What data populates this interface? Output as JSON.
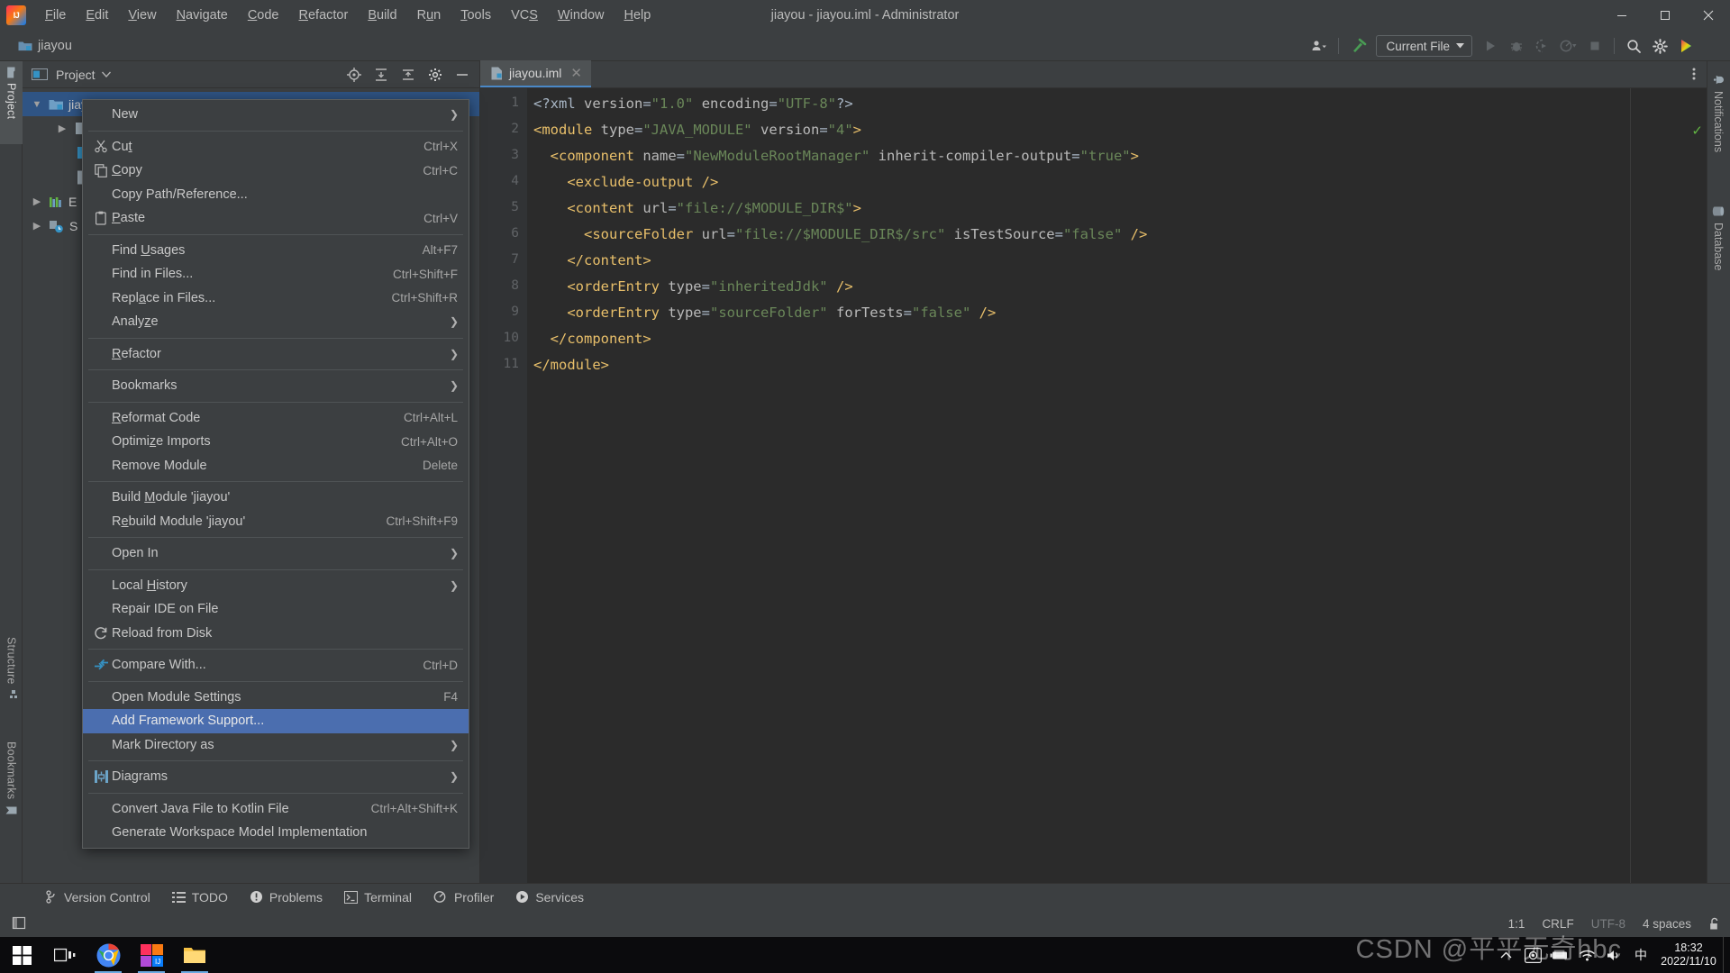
{
  "window": {
    "title": "jiayou - jiayou.iml - Administrator",
    "minimize_label": "Minimize",
    "maximize_label": "Maximize",
    "close_label": "Close"
  },
  "menubar": {
    "items": [
      {
        "label": "File",
        "mnemonic": "F"
      },
      {
        "label": "Edit",
        "mnemonic": "E"
      },
      {
        "label": "View",
        "mnemonic": "V"
      },
      {
        "label": "Navigate",
        "mnemonic": "N"
      },
      {
        "label": "Code",
        "mnemonic": "C"
      },
      {
        "label": "Refactor",
        "mnemonic": "R"
      },
      {
        "label": "Build",
        "mnemonic": "B"
      },
      {
        "label": "Run",
        "mnemonic": "u"
      },
      {
        "label": "Tools",
        "mnemonic": "T"
      },
      {
        "label": "VCS",
        "mnemonic": "S"
      },
      {
        "label": "Window",
        "mnemonic": "W"
      },
      {
        "label": "Help",
        "mnemonic": "H"
      }
    ]
  },
  "navbar": {
    "project_name": "jiayou",
    "run_config": "Current File",
    "icons": {
      "account": "account-icon",
      "chevron": "chevron-down-icon",
      "build": "build-hammer-icon",
      "run": "run-icon",
      "debug": "debug-icon",
      "coverage": "run-with-coverage-icon",
      "profile": "profile-icon",
      "stop": "stop-icon",
      "search": "search-everywhere-icon",
      "settings": "settings-gear-icon",
      "updates": "ide-updates-icon"
    }
  },
  "left_strip": {
    "tabs": [
      {
        "label": "Project",
        "icon": "project-folder-icon",
        "selected": true
      },
      {
        "label": "Structure",
        "icon": "structure-icon",
        "selected": false
      },
      {
        "label": "Bookmarks",
        "icon": "bookmark-icon",
        "selected": false
      }
    ]
  },
  "right_strip": {
    "tabs": [
      {
        "label": "Notifications",
        "icon": "bell-icon"
      },
      {
        "label": "Database",
        "icon": "database-icon"
      }
    ]
  },
  "project_panel": {
    "header_label": "Project",
    "header_icon": "project-window-icon",
    "actions": [
      "locate-file-icon",
      "expand-all-icon",
      "collapse-all-icon",
      "settings-gear-icon",
      "hide-icon"
    ],
    "tree": [
      {
        "label": "jiayou",
        "arrow": "v",
        "icon": "module-folder-icon",
        "selected": true,
        "indent": 0
      },
      {
        "label": "",
        "arrow": ">",
        "icon": "folder-icon",
        "selected": false,
        "indent": 1
      },
      {
        "label": "",
        "arrow": "",
        "icon": "source-folder-icon",
        "selected": false,
        "indent": 1
      },
      {
        "label": "",
        "arrow": "",
        "icon": "iml-file-icon",
        "selected": false,
        "indent": 1
      },
      {
        "label": "E",
        "arrow": ">",
        "icon": "external-libraries-icon",
        "selected": false,
        "indent": 0
      },
      {
        "label": "S",
        "arrow": ">",
        "icon": "scratches-icon",
        "selected": false,
        "indent": 0
      }
    ]
  },
  "editor": {
    "tab": {
      "label": "jiayou.iml",
      "icon": "iml-file-icon",
      "close_icon": "close-icon"
    },
    "inspection_status": "ok-checkmark-icon",
    "line_numbers": [
      "1",
      "2",
      "3",
      "4",
      "5",
      "6",
      "7",
      "8",
      "9",
      "10",
      "11"
    ],
    "lines": [
      [
        {
          "t": "punc",
          "s": "<?xml "
        },
        {
          "t": "attr",
          "s": "version"
        },
        {
          "t": "punc",
          "s": "="
        },
        {
          "t": "val",
          "s": "\"1.0\""
        },
        {
          "t": "punc",
          "s": " "
        },
        {
          "t": "attr",
          "s": "encoding"
        },
        {
          "t": "punc",
          "s": "="
        },
        {
          "t": "val",
          "s": "\"UTF-8\""
        },
        {
          "t": "punc",
          "s": "?>"
        }
      ],
      [
        {
          "t": "tag",
          "s": "<module "
        },
        {
          "t": "attr",
          "s": "type"
        },
        {
          "t": "punc",
          "s": "="
        },
        {
          "t": "val",
          "s": "\"JAVA_MODULE\""
        },
        {
          "t": "punc",
          "s": " "
        },
        {
          "t": "attr",
          "s": "version"
        },
        {
          "t": "punc",
          "s": "="
        },
        {
          "t": "val",
          "s": "\"4\""
        },
        {
          "t": "tag",
          "s": ">"
        }
      ],
      [
        {
          "t": "punc",
          "s": "  "
        },
        {
          "t": "tag",
          "s": "<component "
        },
        {
          "t": "attr",
          "s": "name"
        },
        {
          "t": "punc",
          "s": "="
        },
        {
          "t": "val",
          "s": "\"NewModuleRootManager\""
        },
        {
          "t": "punc",
          "s": " "
        },
        {
          "t": "attr",
          "s": "inherit-compiler-output"
        },
        {
          "t": "punc",
          "s": "="
        },
        {
          "t": "val",
          "s": "\"true\""
        },
        {
          "t": "tag",
          "s": ">"
        }
      ],
      [
        {
          "t": "punc",
          "s": "    "
        },
        {
          "t": "tag",
          "s": "<exclude-output />"
        }
      ],
      [
        {
          "t": "punc",
          "s": "    "
        },
        {
          "t": "tag",
          "s": "<content "
        },
        {
          "t": "attr",
          "s": "url"
        },
        {
          "t": "punc",
          "s": "="
        },
        {
          "t": "val",
          "s": "\"file://$MODULE_DIR$\""
        },
        {
          "t": "tag",
          "s": ">"
        }
      ],
      [
        {
          "t": "punc",
          "s": "      "
        },
        {
          "t": "tag",
          "s": "<sourceFolder "
        },
        {
          "t": "attr",
          "s": "url"
        },
        {
          "t": "punc",
          "s": "="
        },
        {
          "t": "val",
          "s": "\"file://$MODULE_DIR$/src\""
        },
        {
          "t": "punc",
          "s": " "
        },
        {
          "t": "attr",
          "s": "isTestSource"
        },
        {
          "t": "punc",
          "s": "="
        },
        {
          "t": "val",
          "s": "\"false\""
        },
        {
          "t": "punc",
          "s": " "
        },
        {
          "t": "tag",
          "s": "/>"
        }
      ],
      [
        {
          "t": "punc",
          "s": "    "
        },
        {
          "t": "tag",
          "s": "</content>"
        }
      ],
      [
        {
          "t": "punc",
          "s": "    "
        },
        {
          "t": "tag",
          "s": "<orderEntry "
        },
        {
          "t": "attr",
          "s": "type"
        },
        {
          "t": "punc",
          "s": "="
        },
        {
          "t": "val",
          "s": "\"inheritedJdk\""
        },
        {
          "t": "punc",
          "s": " "
        },
        {
          "t": "tag",
          "s": "/>"
        }
      ],
      [
        {
          "t": "punc",
          "s": "    "
        },
        {
          "t": "tag",
          "s": "<orderEntry "
        },
        {
          "t": "attr",
          "s": "type"
        },
        {
          "t": "punc",
          "s": "="
        },
        {
          "t": "val",
          "s": "\"sourceFolder\""
        },
        {
          "t": "punc",
          "s": " "
        },
        {
          "t": "attr",
          "s": "forTests"
        },
        {
          "t": "punc",
          "s": "="
        },
        {
          "t": "val",
          "s": "\"false\""
        },
        {
          "t": "punc",
          "s": " "
        },
        {
          "t": "tag",
          "s": "/>"
        }
      ],
      [
        {
          "t": "punc",
          "s": "  "
        },
        {
          "t": "tag",
          "s": "</component>"
        }
      ],
      [
        {
          "t": "tag",
          "s": "</module>"
        }
      ]
    ]
  },
  "context_menu": {
    "items": [
      {
        "label": "New",
        "mnemonic": "",
        "key": "",
        "icon": "",
        "arrow": true
      },
      {
        "sep": true
      },
      {
        "label": "Cut",
        "mnemonic": "t",
        "key": "Ctrl+X",
        "icon": "scissors-icon"
      },
      {
        "label": "Copy",
        "mnemonic": "C",
        "key": "Ctrl+C",
        "icon": "copy-icon"
      },
      {
        "label": "Copy Path/Reference...",
        "key": "",
        "icon": ""
      },
      {
        "label": "Paste",
        "mnemonic": "P",
        "key": "Ctrl+V",
        "icon": "clipboard-icon"
      },
      {
        "sep": true
      },
      {
        "label": "Find Usages",
        "mnemonic": "U",
        "key": "Alt+F7",
        "icon": ""
      },
      {
        "label": "Find in Files...",
        "key": "Ctrl+Shift+F",
        "icon": ""
      },
      {
        "label": "Replace in Files...",
        "mnemonic": "a",
        "key": "Ctrl+Shift+R",
        "icon": ""
      },
      {
        "label": "Analyze",
        "mnemonic": "z",
        "key": "",
        "icon": "",
        "arrow": true
      },
      {
        "sep": true
      },
      {
        "label": "Refactor",
        "mnemonic": "R",
        "key": "",
        "icon": "",
        "arrow": true
      },
      {
        "sep": true
      },
      {
        "label": "Bookmarks",
        "key": "",
        "icon": "",
        "arrow": true
      },
      {
        "sep": true
      },
      {
        "label": "Reformat Code",
        "mnemonic": "R",
        "key": "Ctrl+Alt+L",
        "icon": ""
      },
      {
        "label": "Optimize Imports",
        "mnemonic": "z",
        "key": "Ctrl+Alt+O",
        "icon": ""
      },
      {
        "label": "Remove Module",
        "key": "Delete",
        "icon": ""
      },
      {
        "sep": true
      },
      {
        "label": "Build Module 'jiayou'",
        "mnemonic": "M",
        "key": "",
        "icon": ""
      },
      {
        "label": "Rebuild Module 'jiayou'",
        "mnemonic": "e",
        "key": "Ctrl+Shift+F9",
        "icon": ""
      },
      {
        "sep": true
      },
      {
        "label": "Open In",
        "key": "",
        "icon": "",
        "arrow": true
      },
      {
        "sep": true
      },
      {
        "label": "Local History",
        "mnemonic": "H",
        "key": "",
        "icon": "",
        "arrow": true
      },
      {
        "label": "Repair IDE on File",
        "key": "",
        "icon": ""
      },
      {
        "label": "Reload from Disk",
        "key": "",
        "icon": "reload-icon"
      },
      {
        "sep": true
      },
      {
        "label": "Compare With...",
        "key": "Ctrl+D",
        "icon": "compare-icon"
      },
      {
        "sep": true
      },
      {
        "label": "Open Module Settings",
        "key": "F4",
        "icon": ""
      },
      {
        "label": "Add Framework Support...",
        "key": "",
        "icon": "",
        "highlighted": true
      },
      {
        "label": "Mark Directory as",
        "key": "",
        "icon": "",
        "arrow": true
      },
      {
        "sep": true
      },
      {
        "label": "Diagrams",
        "key": "",
        "icon": "diagram-icon",
        "arrow": true
      },
      {
        "sep": true
      },
      {
        "label": "Convert Java File to Kotlin File",
        "key": "Ctrl+Alt+Shift+K",
        "icon": ""
      },
      {
        "label": "Generate Workspace Model Implementation",
        "key": "",
        "icon": ""
      }
    ]
  },
  "bottom_bar": {
    "buttons": [
      {
        "label": "Version Control",
        "icon": "branch-icon"
      },
      {
        "label": "TODO",
        "icon": "todo-list-icon"
      },
      {
        "label": "Problems",
        "icon": "problems-icon"
      },
      {
        "label": "Terminal",
        "icon": "terminal-icon"
      },
      {
        "label": "Profiler",
        "icon": "profiler-icon"
      },
      {
        "label": "Services",
        "icon": "services-icon"
      }
    ]
  },
  "status_bar": {
    "left_icon": "toggle-tool-window-icon",
    "caret_position": "1:1",
    "line_separator": "CRLF",
    "encoding": "UTF-8",
    "indent": "4 spaces",
    "lock_icon": "unlocked-icon"
  },
  "taskbar": {
    "buttons": [
      {
        "name": "start-button",
        "icon": "windows-logo-icon"
      },
      {
        "name": "task-view-button",
        "icon": "task-view-icon"
      },
      {
        "name": "chrome-button",
        "icon": "chrome-icon",
        "active": true
      },
      {
        "name": "intellij-button",
        "icon": "intellij-icon",
        "active": true
      },
      {
        "name": "file-explorer-button",
        "icon": "folder-icon",
        "active": true
      }
    ],
    "tray": [
      "show-hidden-icons-chevron",
      "screen-capture-icon",
      "battery-icon",
      "wifi-icon",
      "volume-icon",
      "ime-cn-icon"
    ],
    "clock_time": "18:32",
    "clock_date": "2022/11/10"
  },
  "watermark": {
    "text": "CSDN @平平无奇hbc"
  },
  "colors": {
    "accent_blue": "#4b6eaf",
    "panel_bg": "#3c3f41",
    "editor_bg": "#2b2b2b",
    "gutter_bg": "#313335",
    "tag": "#e8bf6a",
    "value": "#6a8759",
    "selection": "#2f5484"
  }
}
